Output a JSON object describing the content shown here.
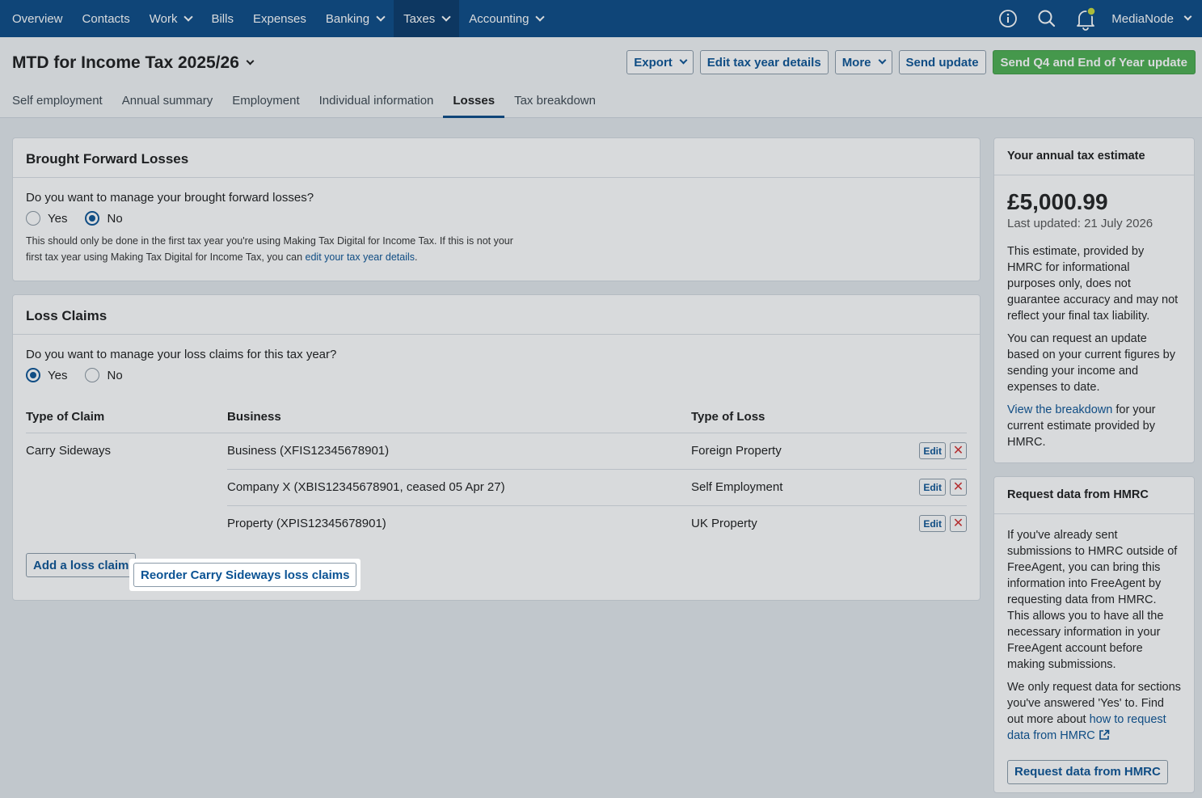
{
  "nav": {
    "items": [
      {
        "label": "Overview",
        "dropdown": false
      },
      {
        "label": "Contacts",
        "dropdown": false
      },
      {
        "label": "Work",
        "dropdown": true
      },
      {
        "label": "Bills",
        "dropdown": false
      },
      {
        "label": "Expenses",
        "dropdown": false
      },
      {
        "label": "Banking",
        "dropdown": true
      },
      {
        "label": "Taxes",
        "dropdown": true,
        "active": true
      },
      {
        "label": "Accounting",
        "dropdown": true
      }
    ],
    "org_name": "MediaNode"
  },
  "header": {
    "title": "MTD for Income Tax 2025/26",
    "buttons": {
      "export": "Export",
      "edit_details": "Edit tax year details",
      "more": "More",
      "send_update": "Send update",
      "send_final": "Send Q4 and End of Year update"
    },
    "tabs": [
      "Self employment",
      "Annual summary",
      "Employment",
      "Individual information",
      "Losses",
      "Tax breakdown"
    ],
    "active_tab": "Losses"
  },
  "brought_forward": {
    "heading": "Brought Forward Losses",
    "question": "Do you want to manage your brought forward losses?",
    "yes": "Yes",
    "no": "No",
    "selected": "No",
    "note_1": "This should only be done in the first tax year you're using Making Tax Digital for Income Tax. If this is not your first tax year using Making Tax Digital for Income Tax, you can ",
    "note_link": "edit your tax year details",
    "note_2": "."
  },
  "loss_claims": {
    "heading": "Loss Claims",
    "question": "Do you want to manage your loss claims for this tax year?",
    "yes": "Yes",
    "no": "No",
    "selected": "Yes",
    "columns": [
      "Type of Claim",
      "Business",
      "Type of Loss"
    ],
    "claim_type": "Carry Sideways",
    "rows": [
      {
        "business": "Business (XFIS12345678901)",
        "loss_type": "Foreign Property"
      },
      {
        "business": "Company X (XBIS12345678901, ceased 05 Apr 27)",
        "loss_type": "Self Employment"
      },
      {
        "business": "Property (XPIS12345678901)",
        "loss_type": "UK Property"
      }
    ],
    "edit_label": "Edit",
    "add_button": "Add a loss claim",
    "reorder_button": "Reorder Carry Sideways loss claims"
  },
  "estimate": {
    "heading": "Your annual tax estimate",
    "amount": "£5,000.99",
    "updated": "Last updated: 21 July 2026",
    "p1": "This estimate, provided by HMRC for informational purposes only, does not guarantee accuracy and may not reflect your final tax liability.",
    "p2": "You can request an update based on your current figures by sending your income and expenses to date.",
    "p3_link": "View the breakdown",
    "p3_rest": " for your current estimate provided by HMRC."
  },
  "request": {
    "heading": "Request data from HMRC",
    "p1": "If you've already sent submissions to HMRC outside of FreeAgent, you can bring this information into FreeAgent by requesting data from HMRC. This allows you to have all the necessary information in your FreeAgent account before making submissions.",
    "p2": "We only request data for sections you've answered 'Yes' to. Find out more about ",
    "p2_link": "how to request data from HMRC",
    "button": "Request data from HMRC"
  },
  "colors": {
    "nav_bg": "#0a4a86",
    "accent": "#0b5394",
    "green": "#4caf50",
    "delete": "#d32f2f"
  }
}
